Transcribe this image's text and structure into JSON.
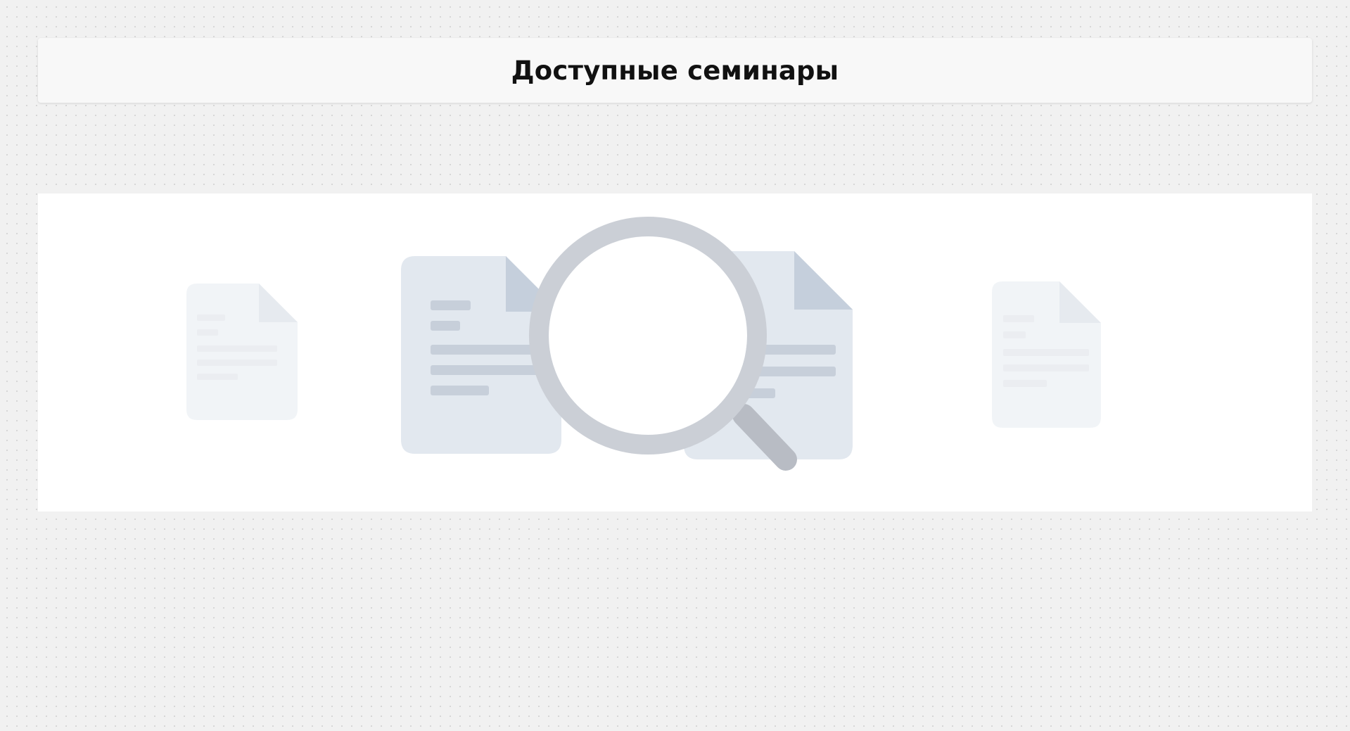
{
  "header": {
    "title": "Доступные семинары"
  },
  "empty_state": {
    "illustration": "documents-search-illustration",
    "icons": [
      "document-icon",
      "document-icon",
      "magnifier-icon",
      "document-icon",
      "document-icon"
    ]
  },
  "colors": {
    "page_background": "#f1f1f1",
    "header_background": "#f8f8f8",
    "panel_background": "#ffffff",
    "document_front": "#e2e8ef",
    "document_fold": "#c5cfdc",
    "document_lines": "#c7cfda",
    "magnifier_ring": "#cbcfd6",
    "magnifier_handle": "#b8bcc4"
  }
}
